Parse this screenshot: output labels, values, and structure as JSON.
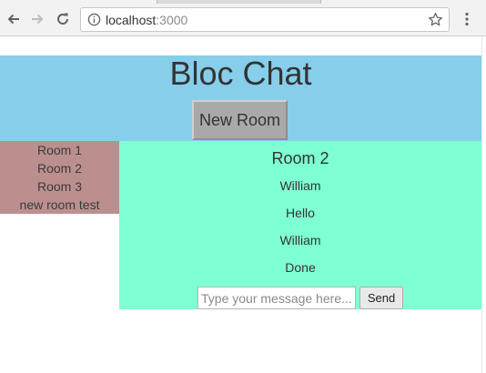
{
  "browser": {
    "url_host": "localhost",
    "url_port": ":3000",
    "icons": {
      "back": "back-arrow-icon",
      "forward": "forward-arrow-icon",
      "reload": "reload-icon",
      "site_info": "info-icon",
      "bookmark": "star-icon",
      "menu": "kebab-menu-icon"
    }
  },
  "header": {
    "title": "Bloc Chat",
    "new_room_label": "New Room",
    "background_color": "#87ceeb"
  },
  "sidebar": {
    "background_color": "#bc8f8f",
    "rooms": [
      {
        "label": "Room 1"
      },
      {
        "label": "Room 2"
      },
      {
        "label": "Room 3"
      },
      {
        "label": "new room test"
      }
    ]
  },
  "chat": {
    "background_color": "#7fffd4",
    "room_title": "Room 2",
    "messages": [
      {
        "text": "William"
      },
      {
        "text": "Hello"
      },
      {
        "text": "William"
      },
      {
        "text": "Done"
      }
    ],
    "input_value": "",
    "input_placeholder": "Type your message here...",
    "send_label": "Send"
  }
}
